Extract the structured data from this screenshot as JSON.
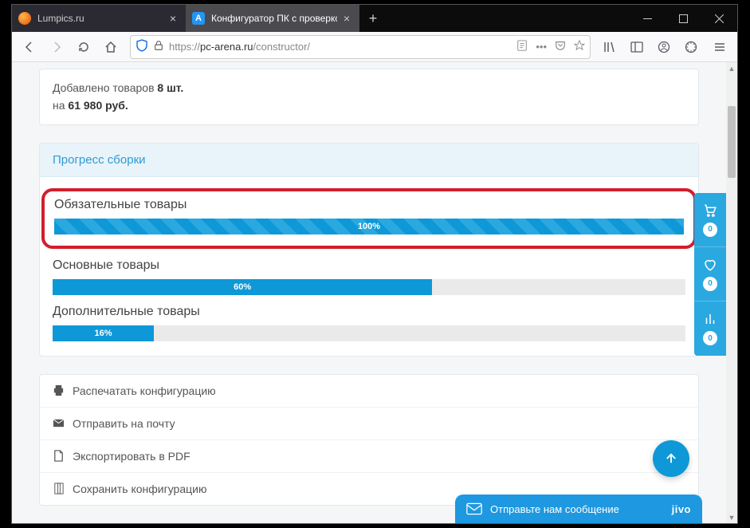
{
  "browser": {
    "tabs": [
      {
        "title": "Lumpics.ru",
        "active": false
      },
      {
        "title": "Конфигуратор ПК с проверко",
        "active": true
      }
    ],
    "url_prefix": "https://",
    "url_host": "pc-arena.ru",
    "url_path": "/constructor/"
  },
  "summary": {
    "line1_prefix": "Добавлено товаров ",
    "line1_bold": "8 шт.",
    "line2_prefix": "на ",
    "line2_bold": "61 980 руб."
  },
  "progress": {
    "header": "Прогресс сборки",
    "items": [
      {
        "label": "Обязательные товары",
        "percent_text": "100%",
        "percent": 100,
        "striped": true,
        "highlighted": true
      },
      {
        "label": "Основные товары",
        "percent_text": "60%",
        "percent": 60,
        "striped": false,
        "highlighted": false
      },
      {
        "label": "Дополнительные товары",
        "percent_text": "16%",
        "percent": 16,
        "striped": false,
        "highlighted": false
      }
    ]
  },
  "actions": {
    "print": "Распечатать конфигурацию",
    "email": "Отправить на почту",
    "pdf": "Экспортировать в PDF",
    "save": "Сохранить конфигурацию"
  },
  "side": {
    "cart": "0",
    "fav": "0",
    "compare": "0"
  },
  "chat": {
    "text": "Отправьте нам сообщение",
    "brand": "jivo"
  }
}
